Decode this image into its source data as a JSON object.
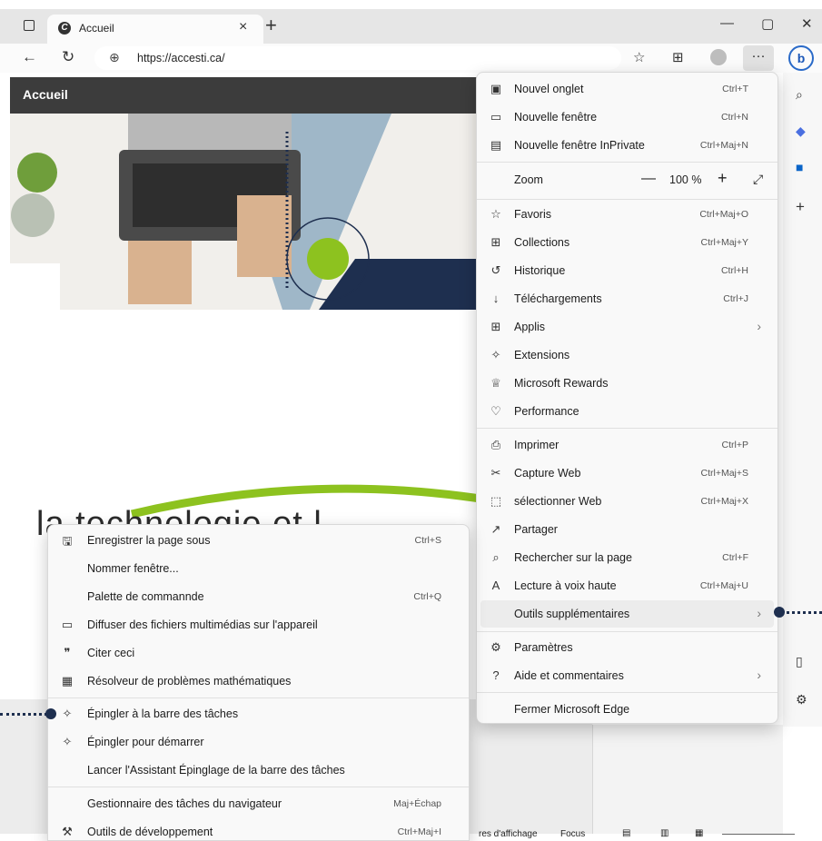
{
  "browser": {
    "tab_title": "Accueil",
    "tab_close": "×",
    "new_tab": "+",
    "minimize": "—",
    "maximize": "▢",
    "close": "✕",
    "url": "https://accesti.ca/",
    "more_label": "···",
    "bing_label": "b"
  },
  "page": {
    "title": "Accueil",
    "heading_fragment": "la technologie et l",
    "status_text": "res d'affichage",
    "status_focus": "Focus"
  },
  "main_menu": {
    "items": [
      {
        "label": "Nouvel onglet",
        "shortcut": "Ctrl+T",
        "icon": "new-tab-icon",
        "glyph": "▣"
      },
      {
        "label": "Nouvelle fenêtre",
        "shortcut": "Ctrl+N",
        "icon": "new-window-icon",
        "glyph": "▭"
      },
      {
        "label": "Nouvelle fenêtre InPrivate",
        "shortcut": "Ctrl+Maj+N",
        "icon": "inprivate-icon",
        "glyph": "▤"
      },
      {
        "label": "Favoris",
        "shortcut": "Ctrl+Maj+O",
        "icon": "favorites-icon",
        "glyph": "☆"
      },
      {
        "label": "Collections",
        "shortcut": "Ctrl+Maj+Y",
        "icon": "collections-icon",
        "glyph": "⊞"
      },
      {
        "label": "Historique",
        "shortcut": "Ctrl+H",
        "icon": "history-icon",
        "glyph": "↺"
      },
      {
        "label": "Téléchargements",
        "shortcut": "Ctrl+J",
        "icon": "downloads-icon",
        "glyph": "↓"
      },
      {
        "label": "Applis",
        "shortcut": "",
        "icon": "apps-icon",
        "glyph": "⊞"
      },
      {
        "label": "Extensions",
        "shortcut": "",
        "icon": "extensions-icon",
        "glyph": "✧"
      },
      {
        "label": "Microsoft Rewards",
        "shortcut": "",
        "icon": "rewards-icon",
        "glyph": "♕"
      },
      {
        "label": "Performance",
        "shortcut": "",
        "icon": "performance-icon",
        "glyph": "♡"
      },
      {
        "label": "Imprimer",
        "shortcut": "Ctrl+P",
        "icon": "print-icon",
        "glyph": "⎙"
      },
      {
        "label": "Capture Web",
        "shortcut": "Ctrl+Maj+S",
        "icon": "capture-icon",
        "glyph": "✂"
      },
      {
        "label": "sélectionner Web",
        "shortcut": "Ctrl+Maj+X",
        "icon": "select-web-icon",
        "glyph": "⬚"
      },
      {
        "label": "Partager",
        "shortcut": "",
        "icon": "share-icon",
        "glyph": "↗"
      },
      {
        "label": "Rechercher sur la page",
        "shortcut": "Ctrl+F",
        "icon": "find-icon",
        "glyph": "⌕"
      },
      {
        "label": "Lecture à voix haute",
        "shortcut": "Ctrl+Maj+U",
        "icon": "read-aloud-icon",
        "glyph": "A"
      },
      {
        "label": "Outils supplémentaires",
        "shortcut": "",
        "icon": "",
        "glyph": ""
      },
      {
        "label": "Paramètres",
        "shortcut": "",
        "icon": "settings-icon",
        "glyph": "⚙"
      },
      {
        "label": "Aide et commentaires",
        "shortcut": "",
        "icon": "help-icon",
        "glyph": "?"
      },
      {
        "label": "Fermer Microsoft Edge",
        "shortcut": "",
        "icon": "",
        "glyph": ""
      }
    ],
    "zoom": {
      "label": "Zoom",
      "minus": "—",
      "value": "100 %",
      "plus": "+",
      "fullscreen": "⤢"
    },
    "arrow": "›"
  },
  "sub_menu": {
    "items": [
      {
        "label": "Enregistrer la page sous",
        "shortcut": "Ctrl+S",
        "icon": "save-page-icon",
        "glyph": "💾"
      },
      {
        "label": "Nommer fenêtre...",
        "shortcut": "",
        "icon": "",
        "glyph": ""
      },
      {
        "label": "Palette de commannde",
        "shortcut": "Ctrl+Q",
        "icon": "",
        "glyph": ""
      },
      {
        "label": "Diffuser des fichiers multimédias sur l'appareil",
        "shortcut": "",
        "icon": "cast-icon",
        "glyph": "▭"
      },
      {
        "label": "Citer ceci",
        "shortcut": "",
        "icon": "quote-icon",
        "glyph": "❞"
      },
      {
        "label": "Résolveur de problèmes mathématiques",
        "shortcut": "",
        "icon": "math-solver-icon",
        "glyph": "▦"
      },
      {
        "label": "Épingler à la barre des tâches",
        "shortcut": "",
        "icon": "pin-taskbar-icon",
        "glyph": "✧"
      },
      {
        "label": "Épingler pour démarrer",
        "shortcut": "",
        "icon": "pin-start-icon",
        "glyph": "✧"
      },
      {
        "label": "Lancer l'Assistant Épinglage de la barre des tâches",
        "shortcut": "",
        "icon": "",
        "glyph": ""
      },
      {
        "label": "Gestionnaire des tâches du navigateur",
        "shortcut": "Maj+Échap",
        "icon": "",
        "glyph": ""
      },
      {
        "label": "Outils de développement",
        "shortcut": "Ctrl+Maj+I",
        "icon": "devtools-icon",
        "glyph": "⚒"
      }
    ]
  },
  "colors": {
    "navy": "#1e2f4f",
    "green": "#8dc21f",
    "header": "#3c3c3c"
  }
}
